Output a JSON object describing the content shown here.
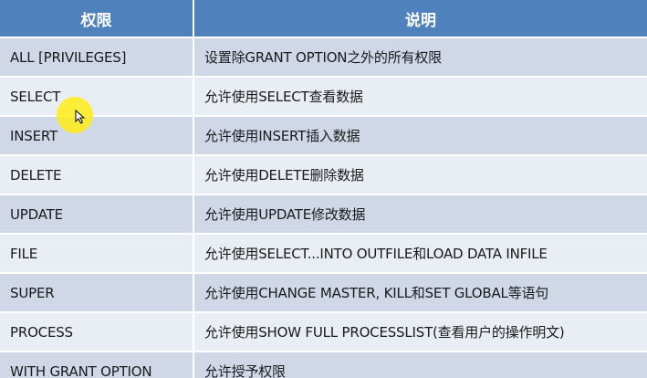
{
  "table": {
    "headers": [
      "权限",
      "说明"
    ],
    "rows": [
      {
        "privilege": "ALL [PRIVILEGES]",
        "description": "设置除GRANT OPTION之外的所有权限"
      },
      {
        "privilege": "SELECT",
        "description": "允许使用SELECT查看数据"
      },
      {
        "privilege": "INSERT",
        "description": "允许使用INSERT插入数据"
      },
      {
        "privilege": "DELETE",
        "description": "允许使用DELETE删除数据"
      },
      {
        "privilege": "UPDATE",
        "description": "允许使用UPDATE修改数据"
      },
      {
        "privilege": "FILE",
        "description": "允许使用SELECT...INTO OUTFILE和LOAD DATA INFILE"
      },
      {
        "privilege": "SUPER",
        "description": "允许使用CHANGE MASTER, KILL和SET GLOBAL等语句"
      },
      {
        "privilege": "PROCESS",
        "description": "允许使用SHOW FULL PROCESSLIST(查看用户的操作明文)"
      },
      {
        "privilege": "WITH GRANT OPTION",
        "description": "允许授予权限"
      }
    ]
  },
  "colors": {
    "header_bg": "#4f81bd",
    "row_odd": "#d0d8e8",
    "row_even": "#e9edf4",
    "cursor_highlight": "#ffec14"
  },
  "icons": {
    "cursor": "mouse-pointer-icon"
  }
}
